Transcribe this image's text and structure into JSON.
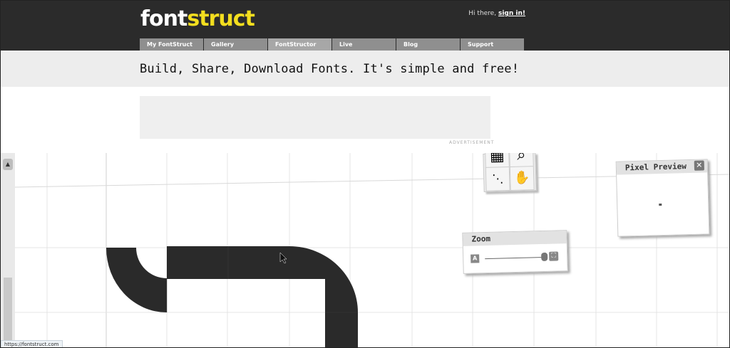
{
  "header": {
    "logo": {
      "part1": "font",
      "part2": "struct"
    },
    "greeting": "Hi there,",
    "sign_in": "sign in!"
  },
  "nav": {
    "tabs": [
      {
        "label": "My FontStruct"
      },
      {
        "label": "Gallery"
      },
      {
        "label": "FontStructor"
      },
      {
        "label": "Live"
      },
      {
        "label": "Blog"
      },
      {
        "label": "Support"
      }
    ]
  },
  "banner": {
    "tagline": "Build, Share, Download Fonts. It's simple and free!"
  },
  "ad": {
    "label": "ADVERTISEMENT"
  },
  "editor": {
    "pixel_preview": {
      "title": "Pixel Preview",
      "close": "✕"
    },
    "zoom": {
      "title": "Zoom",
      "small_icon": "A",
      "fit_icon": "⛶"
    },
    "tools": {
      "icons": [
        "grid-icon",
        "zoom-icon",
        "diagonal-icon",
        "hand-icon"
      ]
    },
    "scroll_up": "▲"
  },
  "status": {
    "url": "https://fontstruct.com"
  },
  "colors": {
    "header_bg": "#2b2b2b",
    "logo_accent": "#f3de1f",
    "nav_tab": "#8f8f8f",
    "glyph": "#2a2a2a"
  }
}
